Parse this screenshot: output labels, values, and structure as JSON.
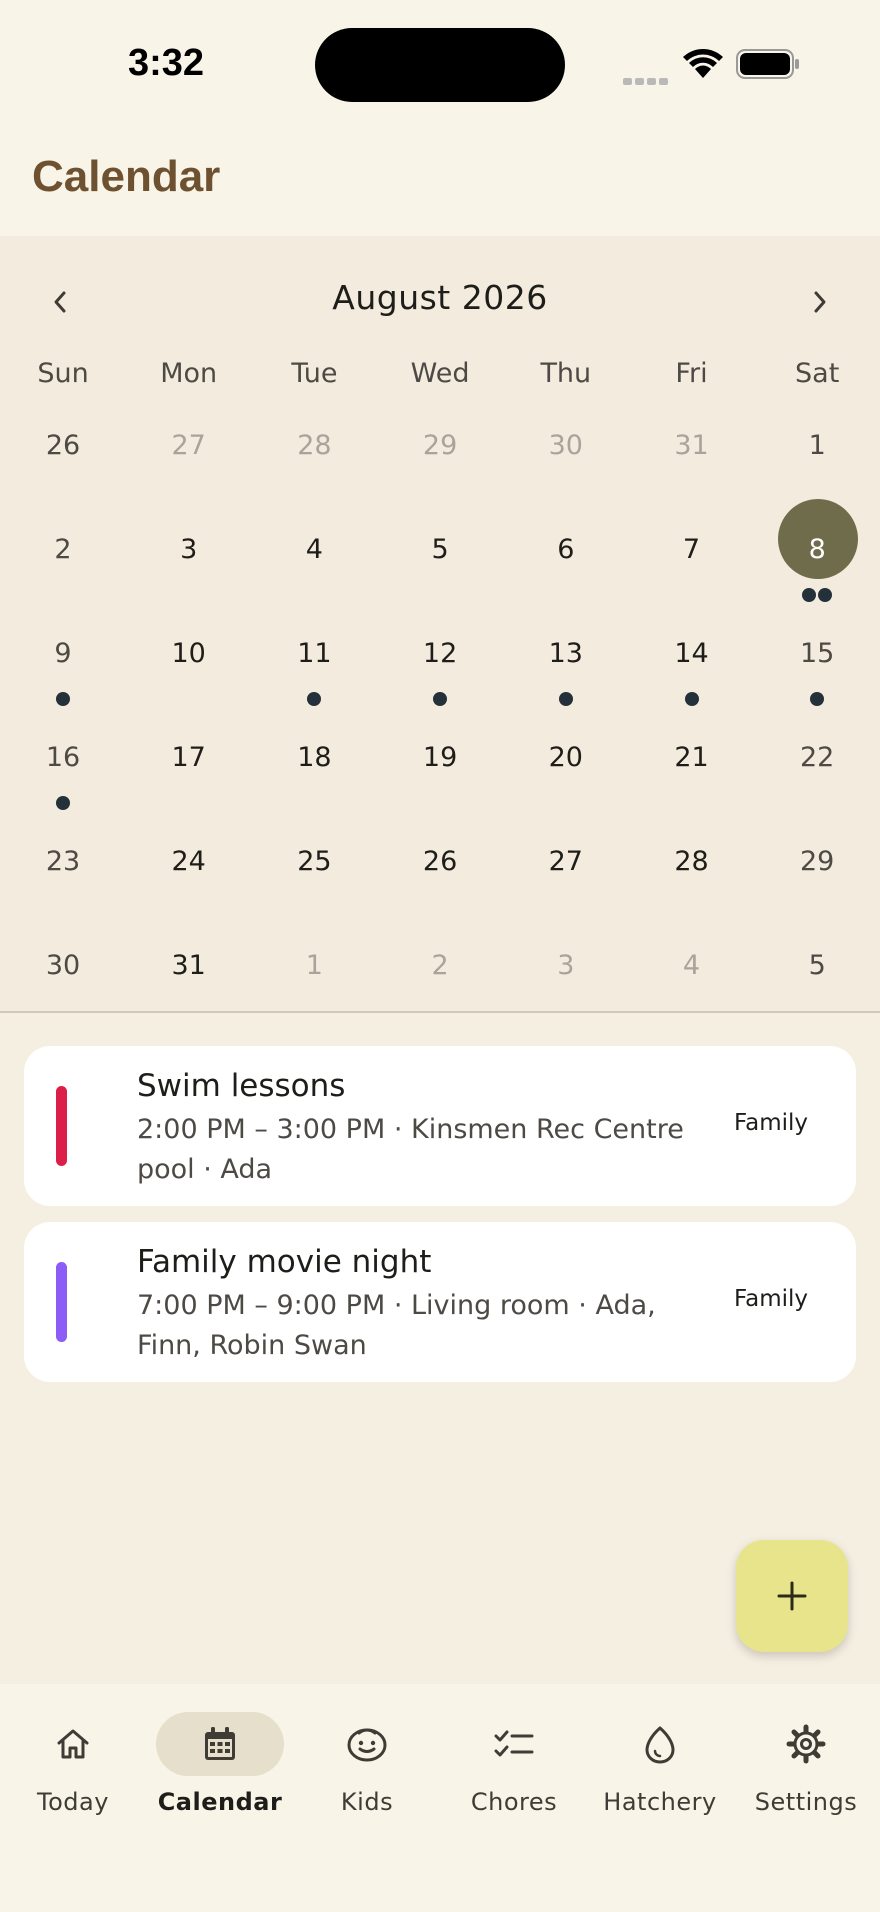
{
  "status_bar": {
    "time": "3:32"
  },
  "header": {
    "title": "Calendar"
  },
  "calendar": {
    "month_label": "August 2026",
    "weekdays": [
      "Sun",
      "Mon",
      "Tue",
      "Wed",
      "Thu",
      "Fri",
      "Sat"
    ],
    "weeks": [
      [
        {
          "d": "26",
          "outside": true
        },
        {
          "d": "27",
          "outside": true
        },
        {
          "d": "28",
          "outside": true
        },
        {
          "d": "29",
          "outside": true
        },
        {
          "d": "30",
          "outside": true
        },
        {
          "d": "31",
          "outside": true
        },
        {
          "d": "1"
        }
      ],
      [
        {
          "d": "2"
        },
        {
          "d": "3"
        },
        {
          "d": "4"
        },
        {
          "d": "5"
        },
        {
          "d": "6"
        },
        {
          "d": "7"
        },
        {
          "d": "8",
          "selected": true,
          "dots": 2
        }
      ],
      [
        {
          "d": "9",
          "dots": 1
        },
        {
          "d": "10"
        },
        {
          "d": "11",
          "dots": 1
        },
        {
          "d": "12",
          "dots": 1
        },
        {
          "d": "13",
          "dots": 1
        },
        {
          "d": "14",
          "dots": 1
        },
        {
          "d": "15",
          "dots": 1
        }
      ],
      [
        {
          "d": "16",
          "dots": 1
        },
        {
          "d": "17"
        },
        {
          "d": "18"
        },
        {
          "d": "19"
        },
        {
          "d": "20"
        },
        {
          "d": "21"
        },
        {
          "d": "22"
        }
      ],
      [
        {
          "d": "23"
        },
        {
          "d": "24"
        },
        {
          "d": "25"
        },
        {
          "d": "26"
        },
        {
          "d": "27"
        },
        {
          "d": "28"
        },
        {
          "d": "29"
        }
      ],
      [
        {
          "d": "30"
        },
        {
          "d": "31"
        },
        {
          "d": "1",
          "outside": true
        },
        {
          "d": "2",
          "outside": true
        },
        {
          "d": "3",
          "outside": true
        },
        {
          "d": "4",
          "outside": true
        },
        {
          "d": "5",
          "outside": true
        }
      ]
    ]
  },
  "events": [
    {
      "title": "Swim lessons",
      "meta": "2:00 PM – 3:00 PM · Kinsmen Rec Centre pool · Ada",
      "tag": "Family",
      "color": "#dc1f4a"
    },
    {
      "title": "Family movie night",
      "meta": "7:00 PM – 9:00 PM · Living room · Ada, Finn, Robin Swan",
      "tag": "Family",
      "color": "#8b5cf6"
    }
  ],
  "fab": {
    "icon": "plus-icon"
  },
  "nav": {
    "items": [
      {
        "label": "Today",
        "icon": "home-icon"
      },
      {
        "label": "Calendar",
        "icon": "calendar-icon",
        "active": true
      },
      {
        "label": "Kids",
        "icon": "face-icon"
      },
      {
        "label": "Chores",
        "icon": "checklist-icon"
      },
      {
        "label": "Hatchery",
        "icon": "egg-icon"
      },
      {
        "label": "Settings",
        "icon": "gear-icon"
      }
    ]
  },
  "colors": {
    "accent": "#6e5130",
    "selected_day": "#6f6c4c",
    "fab": "#e8e48c",
    "event_dot": "#24303a"
  }
}
